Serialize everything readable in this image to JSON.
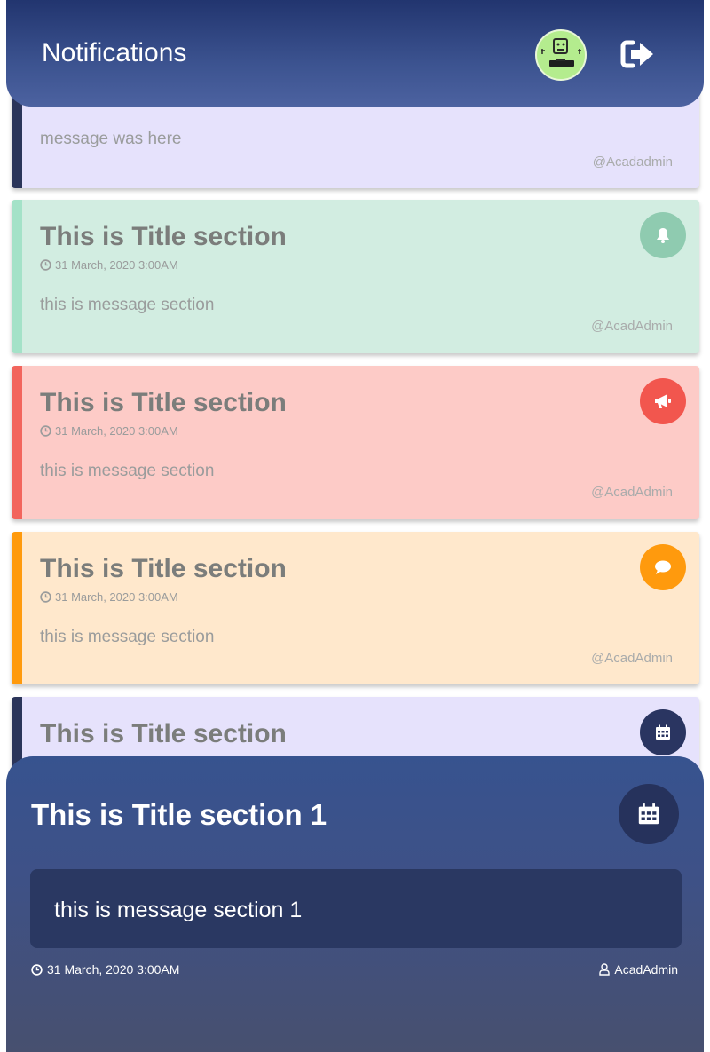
{
  "header": {
    "title": "Notifications",
    "avatar_icon": "user-avatar",
    "logout_icon": "sign-out-icon"
  },
  "cards": [
    {
      "title": "",
      "date": "",
      "message": "message was here",
      "author": "@Acadadmin",
      "accent": "#2b355a",
      "background": "#e6e2fc",
      "icon": ""
    },
    {
      "title": "This is Title section",
      "date": "31 March, 2020 3:00AM",
      "message": "this is message section",
      "author": "@AcadAdmin",
      "accent": "#a4e2c8",
      "background": "#d2ede1",
      "icon": "bell-icon",
      "icon_color": "#8fcbb0"
    },
    {
      "title": "This is Title section",
      "date": "31 March, 2020 3:00AM",
      "message": "this is message section",
      "author": "@AcadAdmin",
      "accent": "#f2655d",
      "background": "#fdcbc7",
      "icon": "bullhorn-icon",
      "icon_color": "#f2564e"
    },
    {
      "title": "This is Title section",
      "date": "31 March, 2020 3:00AM",
      "message": "this is message section",
      "author": "@AcadAdmin",
      "accent": "#ff9a0d",
      "background": "#ffe8cc",
      "icon": "comment-icon",
      "icon_color": "#ff9a0d"
    },
    {
      "title": "This is Title section",
      "date": "",
      "message": "",
      "author": "",
      "accent": "#2b355a",
      "background": "#e6e2fc",
      "icon": "calendar-icon",
      "icon_color": "#2a3561"
    }
  ],
  "detail": {
    "title": "This is Title section 1",
    "message": "this is message section 1",
    "date": "31 March, 2020 3:00AM",
    "author": "AcadAdmin",
    "icon": "calendar-icon"
  }
}
